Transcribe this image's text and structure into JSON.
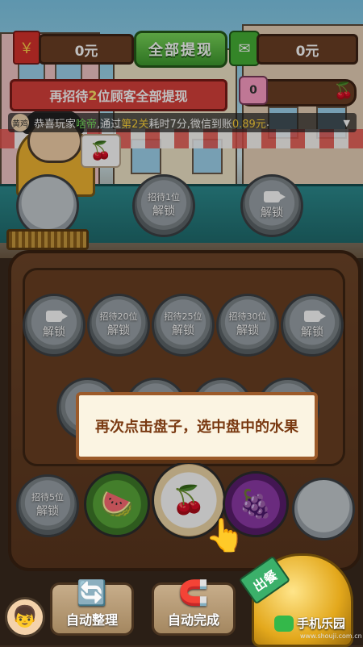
{
  "top_bar": {
    "red_envelope_balance": "0元",
    "withdraw_all_label": "全部提现",
    "wechat_balance": "0元"
  },
  "task": {
    "prefix": "再招待",
    "count": "2",
    "suffix": "位顾客全部提现"
  },
  "progress": {
    "badge": "0"
  },
  "ticker": {
    "avatar_text": "黄鸡",
    "t1": "恭喜玩家",
    "player": "啥帝",
    "t2": ",通过",
    "level": "第2关",
    "t3": "耗时7分,微信到账",
    "amount": "0.89元",
    "t4": "."
  },
  "counter_plates": [
    {
      "line1": "",
      "line2": ""
    },
    {
      "line1": "招待1位",
      "line2": "解锁"
    },
    {
      "line1": "",
      "line2": "解锁"
    }
  ],
  "board_plates_row1": [
    {
      "line1": "",
      "line2": "解锁"
    },
    {
      "line1": "招待20位",
      "line2": "解锁"
    },
    {
      "line1": "招待25位",
      "line2": "解锁"
    },
    {
      "line1": "招待30位",
      "line2": "解锁"
    },
    {
      "line1": "",
      "line2": "解锁"
    }
  ],
  "board_plates_row3": [
    {
      "line1": "招待5位",
      "line2": "解锁"
    }
  ],
  "tutorial": {
    "tip": "再次点击盘子，选中盘中的水果"
  },
  "bottom": {
    "auto_sort": "自动整理",
    "auto_complete": "自动完成",
    "serve": "出餐"
  },
  "watermark": {
    "name": "手机乐园",
    "url": "www.shouji.com.cn"
  },
  "colors": {
    "accent_green": "#3e9a2e",
    "accent_red": "#d9413b",
    "highlight_yellow": "#ffd33a",
    "wood": "#5a361e"
  }
}
